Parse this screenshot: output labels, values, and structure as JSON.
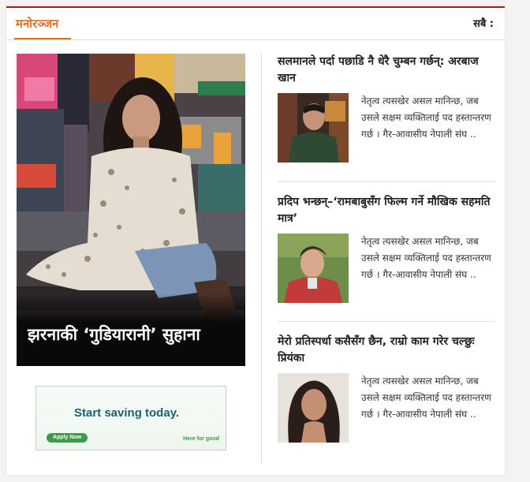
{
  "section": {
    "title": "मनोरञ्जन",
    "view_all": "सबै :"
  },
  "featured": {
    "title": "झरनाकी ‘गुडियारानी’ सुहाना"
  },
  "ad": {
    "headline": "Start saving today.",
    "button": "Apply Now",
    "tagline": "Here for good"
  },
  "articles": [
    {
      "title": "सलमानले पर्दा पछाडि नै धेरै चुम्बन गर्छन्: अरबाज खान",
      "excerpt": "नेतृत्व त्यसखेर असल मानिन्छ, जब उसले सक्षम व्यक्तिलाई पद हस्तान्तरण गर्छ । गैर-आवासीय नेपाली संघ .."
    },
    {
      "title": "प्रदिप भन्छन्–‘रामबाबुसँग फिल्म गर्ने मौखिक सहमति मात्र’",
      "excerpt": "नेतृत्व त्यसखेर असल मानिन्छ, जब उसले सक्षम व्यक्तिलाई पद हस्तान्तरण गर्छ । गैर-आवासीय नेपाली संघ .."
    },
    {
      "title": "मेरो प्रतिस्पर्धा कसैसँग छैन, राम्रो काम गरेर चल्छुः प्रियंका",
      "excerpt": "नेतृत्व त्यसखेर असल मानिन्छ, जब उसले सक्षम व्यक्तिलाई पद हस्तान्तरण गर्छ । गैर-आवासीय नेपाली संघ .."
    }
  ]
}
